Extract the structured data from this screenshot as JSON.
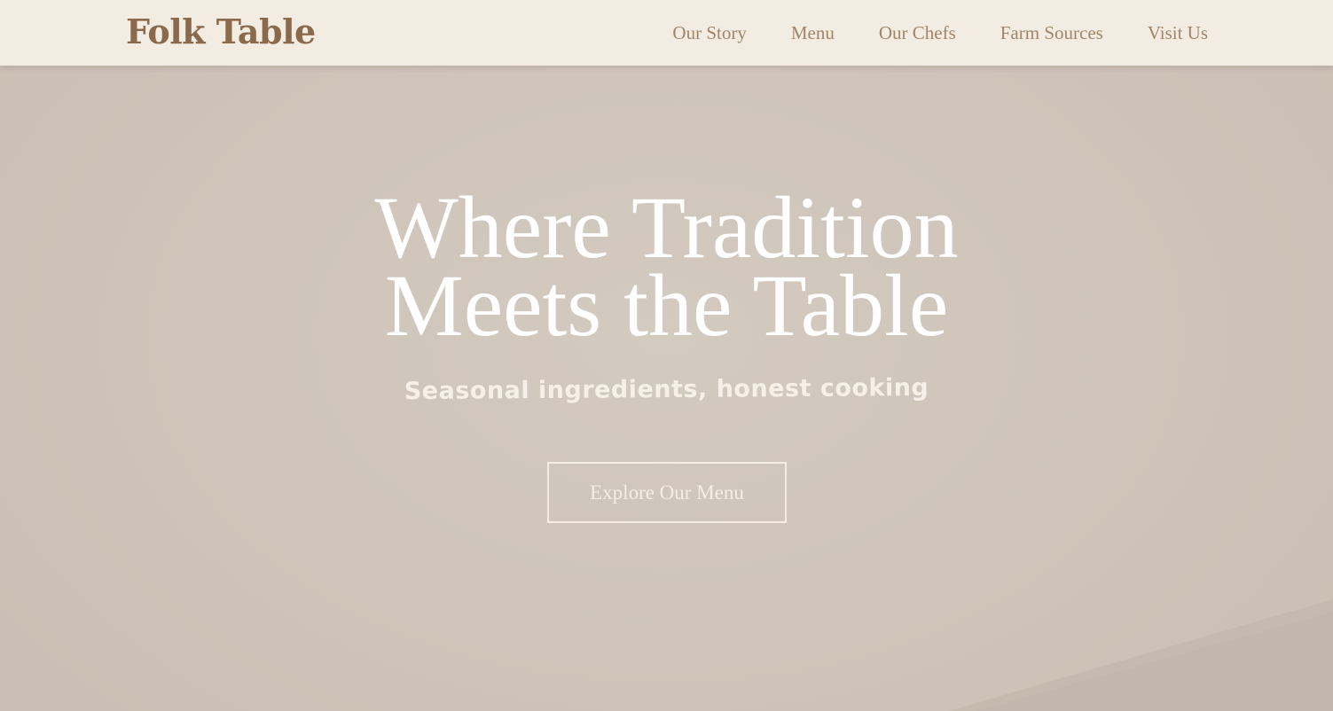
{
  "header": {
    "logo_text": "Folk Table",
    "nav": [
      {
        "label": "Our Story"
      },
      {
        "label": "Menu"
      },
      {
        "label": "Our Chefs"
      },
      {
        "label": "Farm Sources"
      },
      {
        "label": "Visit Us"
      }
    ]
  },
  "hero": {
    "title_line_1": "Where Tradition",
    "title_line_2": "Meets the Table",
    "subtitle": "Seasonal ingredients, honest cooking",
    "cta_label": "Explore Our Menu"
  },
  "colors": {
    "header_bg": "#f3ece3",
    "brand": "#8b6a4c",
    "nav_text": "#a08567",
    "hero_bg": "#cfc5bb",
    "hero_text": "#ffffff"
  }
}
